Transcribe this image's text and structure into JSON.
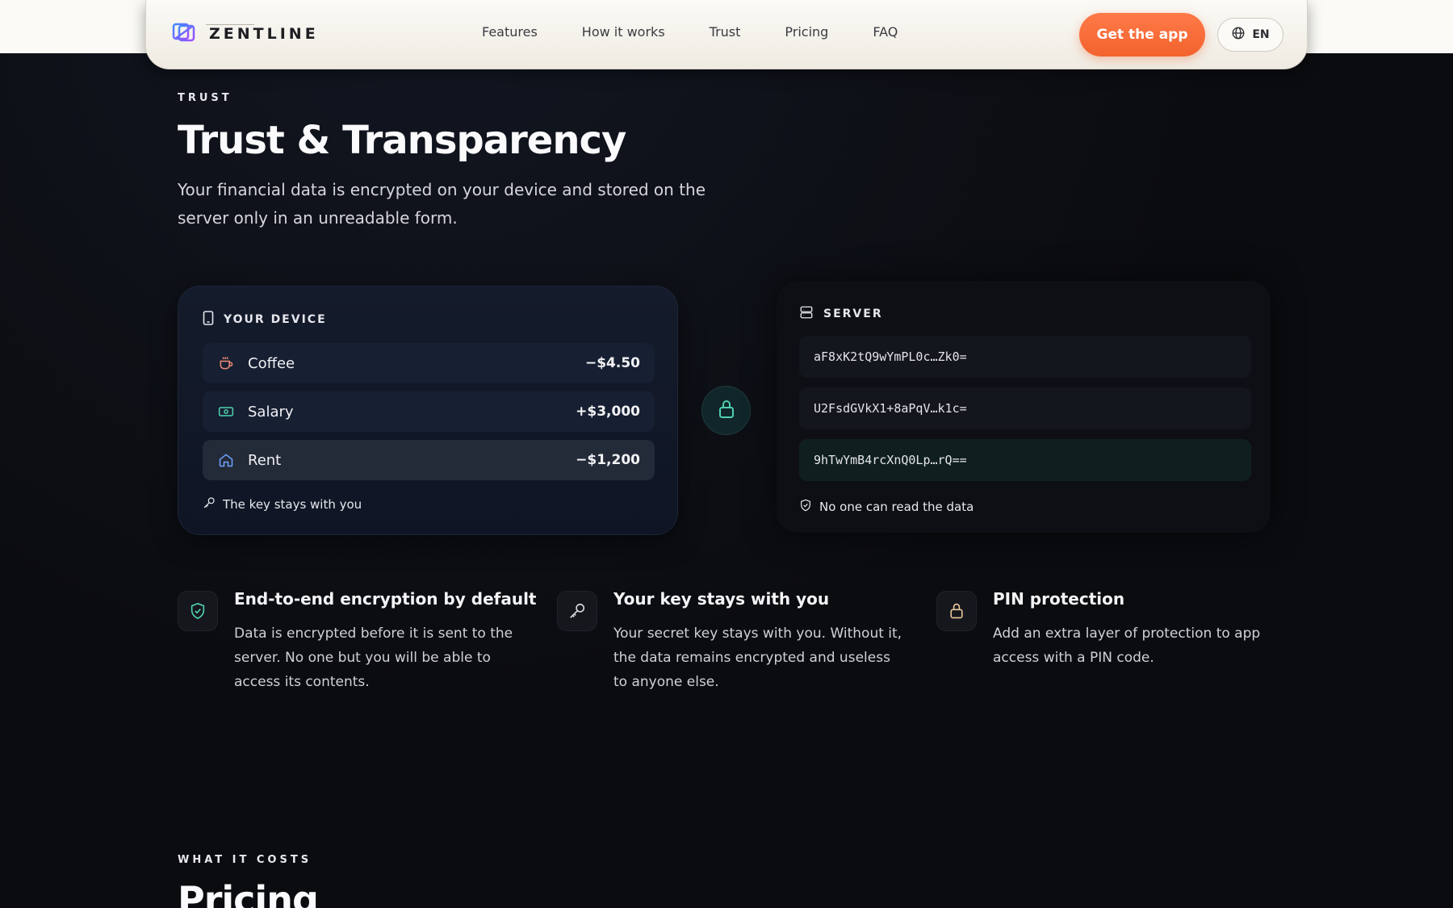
{
  "nav": {
    "brand": "ZENTLINE",
    "links": [
      "Features",
      "How it works",
      "Trust",
      "Pricing",
      "FAQ"
    ],
    "cta": "Get the app",
    "lang": "EN"
  },
  "trust": {
    "eyebrow": "TRUST",
    "title": "Trust & Transparency",
    "lead": "Your financial data is encrypted on your device and stored on the server only in an unreadable form."
  },
  "device": {
    "heading": "YOUR DEVICE",
    "transactions": [
      {
        "icon": "coffee-cup-icon",
        "label": "Coffee",
        "amount": "−$4.50"
      },
      {
        "icon": "banknote-icon",
        "label": "Salary",
        "amount": "+$3,000"
      },
      {
        "icon": "home-icon",
        "label": "Rent",
        "amount": "−$1,200"
      }
    ],
    "footer": "The key stays with you"
  },
  "server": {
    "heading": "SERVER",
    "ciphers": [
      "aF8xK2tQ9wYmPL0c…Zk0=",
      "U2FsdGVkX1+8aPqV…k1c=",
      "9hTwYmB4rcXnQ0Lp…rQ=="
    ],
    "footer": "No one can read the data"
  },
  "features": [
    {
      "icon": "shield-check-icon",
      "title": "End-to-end encryption by default",
      "desc": "Data is encrypted before it is sent to the server. No one but you will be able to access its contents."
    },
    {
      "icon": "key-icon",
      "title": "Your key stays with you",
      "desc": "Your secret key stays with you. Without it, the data remains encrypted and useless to anyone else."
    },
    {
      "icon": "lock-icon",
      "title": "PIN protection",
      "desc": "Add an extra layer of protection to app access with a PIN code."
    }
  ],
  "pricing": {
    "eyebrow": "WHAT IT COSTS",
    "title": "Pricing"
  },
  "colors": {
    "accent": "#f2622d",
    "teal": "#4fd1b0",
    "background": "#0b0c10"
  }
}
